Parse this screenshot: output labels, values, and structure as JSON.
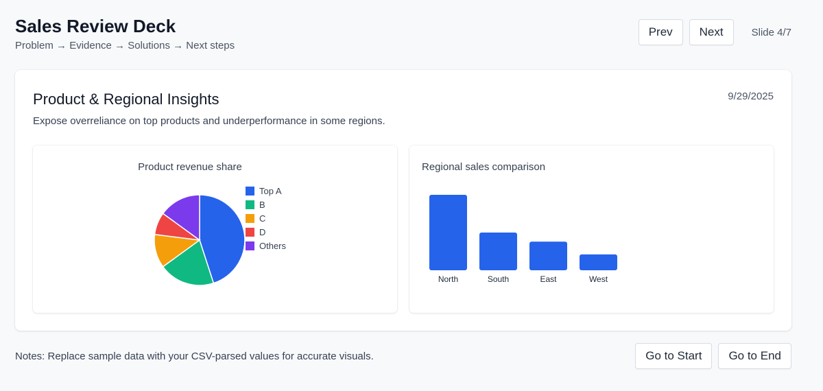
{
  "deck": {
    "title": "Sales Review Deck",
    "subtitle": "Problem → Evidence → Solutions → Next steps"
  },
  "nav": {
    "prev_label": "Prev",
    "next_label": "Next",
    "slide_indicator": "Slide 4/7"
  },
  "slide": {
    "title": "Product & Regional Insights",
    "date": "9/29/2025",
    "description": "Expose overreliance on top products and underperformance in some regions."
  },
  "footer": {
    "notes": "Notes: Replace sample data with your CSV-parsed values for accurate visuals.",
    "start_label": "Go to Start",
    "end_label": "Go to End"
  },
  "colors": {
    "pie": [
      "#2563eb",
      "#10b981",
      "#f59e0b",
      "#ef4444",
      "#7c3aed"
    ],
    "bar": "#2563eb"
  },
  "chart_data": [
    {
      "type": "pie",
      "title": "Product revenue share",
      "categories": [
        "Top A",
        "B",
        "C",
        "D",
        "Others"
      ],
      "values": [
        45,
        20,
        12,
        8,
        15
      ],
      "legend": "right"
    },
    {
      "type": "bar",
      "title": "Regional sales comparison",
      "categories": [
        "North",
        "South",
        "East",
        "West"
      ],
      "values": [
        100,
        50,
        38,
        21
      ],
      "grid": false,
      "legend": "none"
    }
  ]
}
